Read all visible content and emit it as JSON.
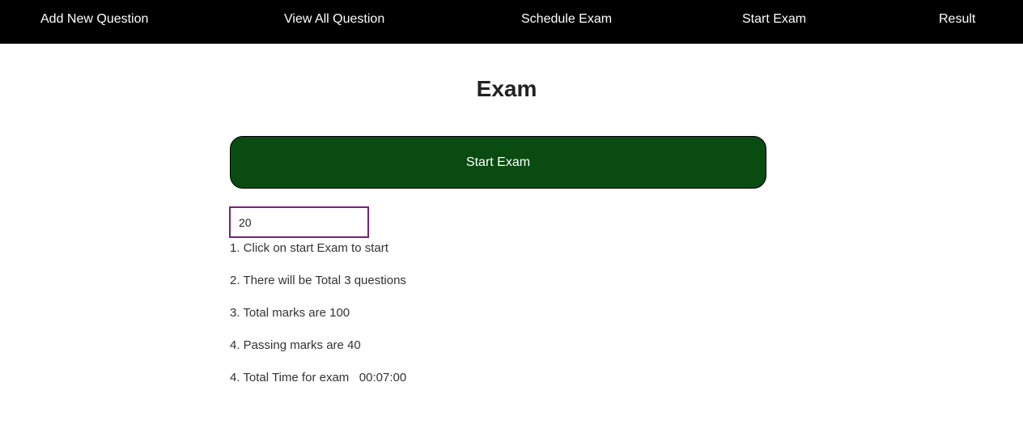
{
  "nav": {
    "items": [
      {
        "label": "Add New Question"
      },
      {
        "label": "View All Question"
      },
      {
        "label": "Schedule Exam"
      },
      {
        "label": "Start Exam"
      },
      {
        "label": "Result"
      }
    ]
  },
  "main": {
    "title": "Exam",
    "start_button_label": "Start Exam",
    "question_count_value": "20",
    "instructions": [
      "1. Click on start Exam to start",
      "2. There will be Total 3 questions",
      "3. Total marks are 100",
      "4. Passing marks are 40",
      "4. Total Time for exam   00:07:00"
    ]
  },
  "colors": {
    "nav_background": "#000000",
    "start_button": "#0a4b12",
    "input_border": "#7a1f7a"
  }
}
